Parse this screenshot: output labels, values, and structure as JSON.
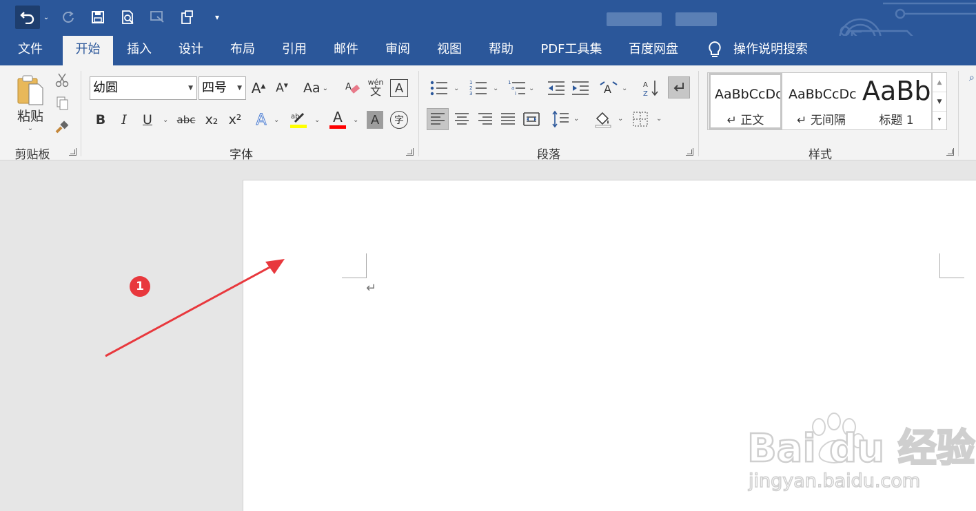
{
  "title_bar": {
    "accent": "#2b579a"
  },
  "tabs": [
    {
      "label": "文件"
    },
    {
      "label": "开始"
    },
    {
      "label": "插入"
    },
    {
      "label": "设计"
    },
    {
      "label": "布局"
    },
    {
      "label": "引用"
    },
    {
      "label": "邮件"
    },
    {
      "label": "审阅"
    },
    {
      "label": "视图"
    },
    {
      "label": "帮助"
    },
    {
      "label": "PDF工具集"
    },
    {
      "label": "百度网盘"
    }
  ],
  "active_tab": "开始",
  "tell_me": {
    "label": "操作说明搜索",
    "icon": "lightbulb-icon"
  },
  "clipboard": {
    "paste_label": "粘贴",
    "group_label": "剪贴板"
  },
  "font": {
    "group_label": "字体",
    "font_name": "幼圆",
    "font_size": "四号",
    "change_case": "Aa",
    "phonetic": "wén\n文",
    "bold": "B",
    "italic": "I",
    "underline": "U",
    "strike": "abc",
    "subscript": "x₂",
    "superscript": "x²",
    "highlight_color": "#ffff00",
    "font_color": "#ff0000"
  },
  "paragraph": {
    "group_label": "段落"
  },
  "styles": {
    "group_label": "样式",
    "items": [
      {
        "preview": "AaBbCcDc",
        "name": "↵ 正文"
      },
      {
        "preview": "AaBbCcDc",
        "name": "↵ 无间隔"
      },
      {
        "preview": "AaBb",
        "name": "标题 1"
      }
    ]
  },
  "annotation": {
    "badge": "1",
    "color": "#e8383d"
  },
  "watermark": {
    "logo": "Bai du 经验",
    "url": "jingyan.baidu.com"
  },
  "document": {
    "paragraph_mark": "↵"
  }
}
